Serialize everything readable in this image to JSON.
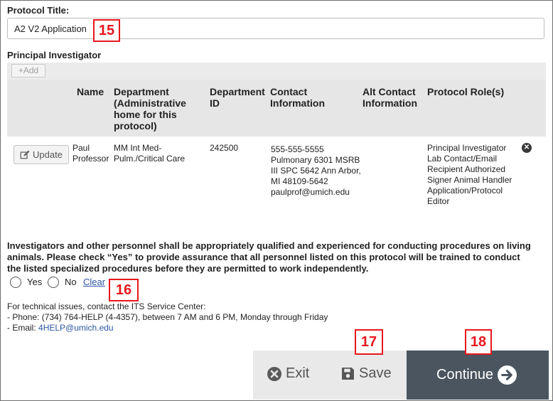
{
  "protocol_title": {
    "label": "Protocol Title:",
    "value": "A2 V2 Application"
  },
  "callouts": {
    "c15": "15",
    "c16": "16",
    "c17": "17",
    "c18": "18"
  },
  "principal_investigator": {
    "heading": "Principal Investigator",
    "add_label": "+Add",
    "columns": {
      "name": "Name",
      "department": "Department (Administrative home for this protocol)",
      "department_id": "Department ID",
      "contact": "Contact Information",
      "alt_contact": "Alt Contact Information",
      "role": "Protocol Role(s)"
    },
    "row": {
      "update_label": "Update",
      "name": "Paul Professor",
      "department": "MM Int Med-Pulm./Critical Care",
      "department_id": "242500",
      "contact_phone": "555-555-5555",
      "contact_address": "Pulmonary 6301 MSRB III SPC 5642 Ann Arbor, MI 48109-5642",
      "contact_email": "paulprof@umich.edu",
      "alt_contact": "",
      "roles": "Principal Investigator Lab Contact/Email Recipient Authorized Signer Animal Handler Application/Protocol Editor"
    }
  },
  "assurance": {
    "text": "Investigators and other personnel shall be appropriately qualified and experienced for conducting procedures on living animals. Please check “Yes” to provide assurance that all personnel listed on this protocol will be trained to conduct the listed specialized procedures before they are permitted to work independently.",
    "yes": "Yes",
    "no": "No",
    "clear": "Clear"
  },
  "help": {
    "line1": "For technical issues, contact the ITS Service Center:",
    "line2": "- Phone: (734) 764-HELP (4-4357), between 7 AM and 6 PM, Monday through Friday",
    "email_prefix": "- Email: ",
    "email": "4HELP@umich.edu"
  },
  "footer": {
    "exit": "Exit",
    "save": "Save",
    "continue": "Continue"
  },
  "colors": {
    "callout": "#e8171e",
    "footer_dark": "#4a5560",
    "footer_light": "#e9e9e9",
    "link": "#2d57a6"
  },
  "icons": {
    "update": "edit-icon",
    "remove": "times-circle-icon",
    "exit": "times-circle-icon",
    "save": "floppy-disk-icon",
    "continue": "arrow-circle-right-icon"
  }
}
